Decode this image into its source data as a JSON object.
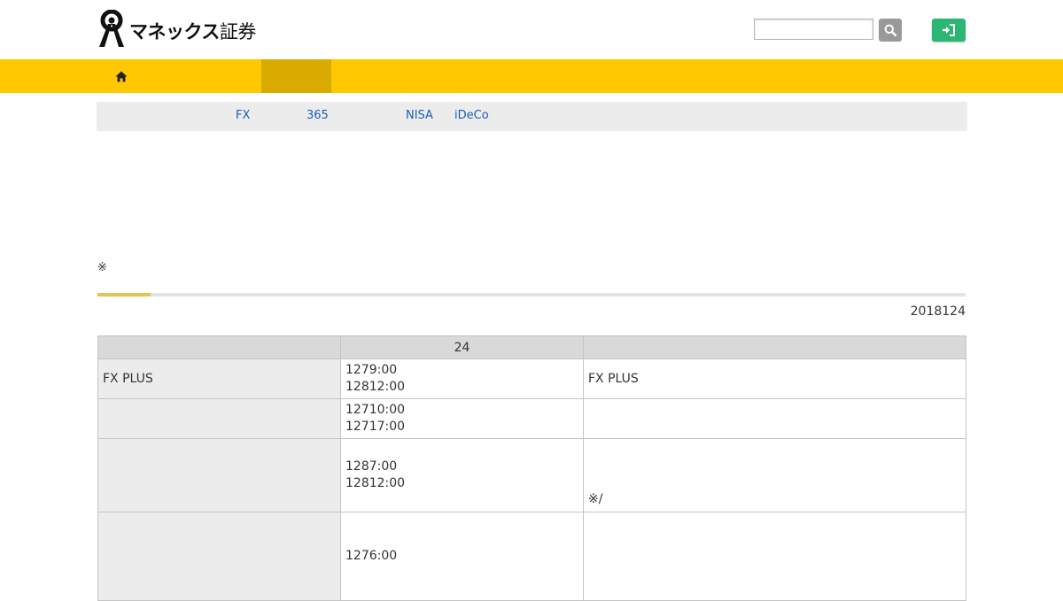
{
  "brand": {
    "name_katakana": "マネックス",
    "name_kanji": "証券"
  },
  "search": {
    "placeholder": ""
  },
  "subnav": [
    {
      "label": "FX"
    },
    {
      "label": "365"
    },
    {
      "label": "NISA"
    },
    {
      "label": "iDeCo"
    }
  ],
  "notice": {
    "mark": "※"
  },
  "progress": {
    "fraction": 0.061
  },
  "date": "2018124",
  "table": {
    "headers": [
      "",
      "24",
      ""
    ],
    "rows": [
      {
        "name": "FX PLUS",
        "times": [
          "1279:00",
          "12812:00"
        ],
        "note": "FX PLUS",
        "note_pos": "middle"
      },
      {
        "name": "",
        "times": [
          "12710:00",
          "12717:00"
        ],
        "note": "",
        "note_pos": "middle"
      },
      {
        "name": "",
        "times": [
          "1287:00",
          "12812:00"
        ],
        "note": "※/",
        "note_pos": "bottom"
      },
      {
        "name": "",
        "times": [
          "1276:00"
        ],
        "note": "",
        "note_pos": "middle"
      }
    ]
  },
  "colors": {
    "nav_bar": "#ffc800",
    "nav_active": "#d9aa00",
    "login_button": "#2bb673",
    "search_button": "#999999",
    "link": "#1a5fb4"
  }
}
